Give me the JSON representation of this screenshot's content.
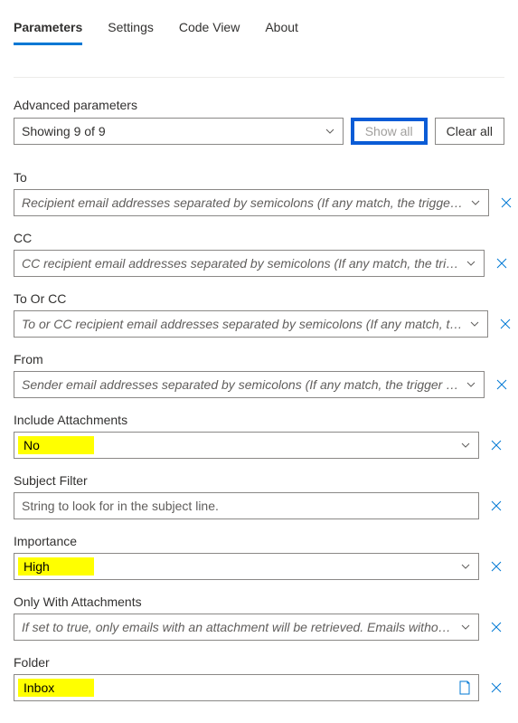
{
  "tabs": {
    "parameters": "Parameters",
    "settings": "Settings",
    "codeview": "Code View",
    "about": "About"
  },
  "advanced": {
    "label": "Advanced parameters",
    "showing": "Showing 9 of 9",
    "show_all": "Show all",
    "clear_all": "Clear all"
  },
  "fields": {
    "to": {
      "label": "To",
      "placeholder": "Recipient email addresses separated by semicolons (If any match, the trigge…"
    },
    "cc": {
      "label": "CC",
      "placeholder": "CC recipient email addresses separated by semicolons (If any match, the tri…"
    },
    "to_or_cc": {
      "label": "To Or CC",
      "placeholder": "To or CC recipient email addresses separated by semicolons (If any match, t…"
    },
    "from": {
      "label": "From",
      "placeholder": "Sender email addresses separated by semicolons (If any match, the trigger …"
    },
    "include_attachments": {
      "label": "Include Attachments",
      "value": "No"
    },
    "subject_filter": {
      "label": "Subject Filter",
      "placeholder": "String to look for in the subject line."
    },
    "importance": {
      "label": "Importance",
      "value": "High"
    },
    "only_with_attachments": {
      "label": "Only With Attachments",
      "placeholder": "If set to true, only emails with an attachment will be retrieved. Emails witho…"
    },
    "folder": {
      "label": "Folder",
      "value": "Inbox"
    }
  }
}
